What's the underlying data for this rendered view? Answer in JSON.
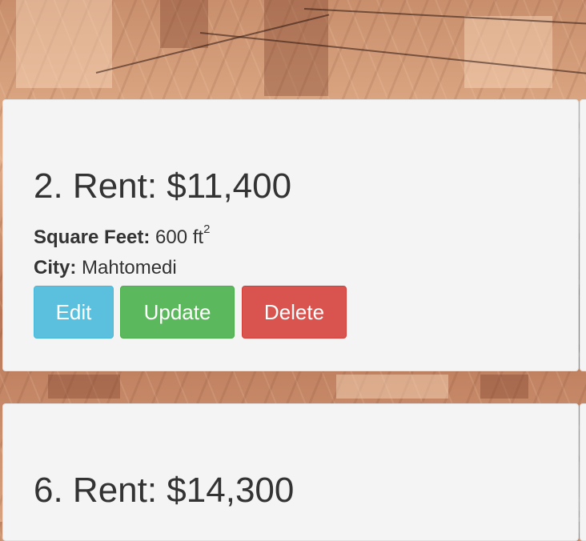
{
  "listings": [
    {
      "heading": "2. Rent: $11,400",
      "sqft_label": "Square Feet:",
      "sqft_value": "600 ft",
      "sqft_unit_exp": "2",
      "city_label": "City:",
      "city_value": "Mahtomedi",
      "buttons": {
        "edit": "Edit",
        "update": "Update",
        "delete": "Delete"
      }
    },
    {
      "heading": "6. Rent: $14,300"
    }
  ],
  "colors": {
    "card_bg": "#f4f4f4",
    "text": "#333333",
    "edit_btn": "#5bc0de",
    "update_btn": "#5cb85c",
    "delete_btn": "#d9534f"
  }
}
